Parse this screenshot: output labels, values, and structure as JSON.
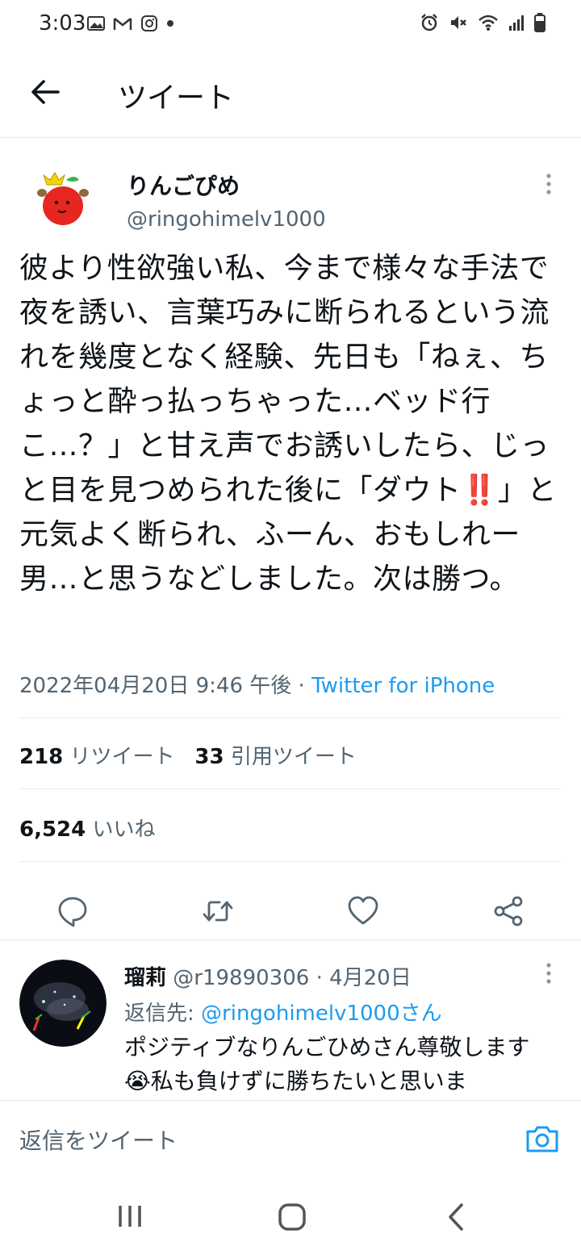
{
  "status_bar": {
    "time": "3:03"
  },
  "app_bar": {
    "title": "ツイート"
  },
  "tweet": {
    "author_name": "りんごぴめ",
    "author_handle": "@ringohimelv1000",
    "text": "彼より性欲強い私、今まで様々な手法で夜を誘い、言葉巧みに断られるという流れを幾度となく経験、先日も「ねぇ、ちょっと酔っ払っちゃった…ベッド行こ…？」と甘え声でお誘いしたら、じっと目を見つめられた後に「ダウト‼️」と元気よく断られ、ふーん、おもしれー男…と思うなどしました。次は勝つ。",
    "datetime": "2022年04月20日 9:46 午後",
    "separator": " · ",
    "source": "Twitter for iPhone",
    "retweets_count": "218",
    "retweets_label": "リツイート",
    "quotes_count": "33",
    "quotes_label": "引用ツイート",
    "likes_count": "6,524",
    "likes_label": "いいね"
  },
  "reply": {
    "name": "瑠莉",
    "handle_date": "@r19890306 · 4月20日",
    "reply_to_label": "返信先: ",
    "reply_to_handle": "@ringohimelv1000さん",
    "text": "ポジティブなりんごひめさん尊敬します😭私も負けずに勝ちたいと思いま"
  },
  "composer": {
    "placeholder": "返信をツイート"
  },
  "colors": {
    "accent": "#1d9bf0",
    "secondary": "#536471",
    "divider": "#e6ecf0"
  }
}
